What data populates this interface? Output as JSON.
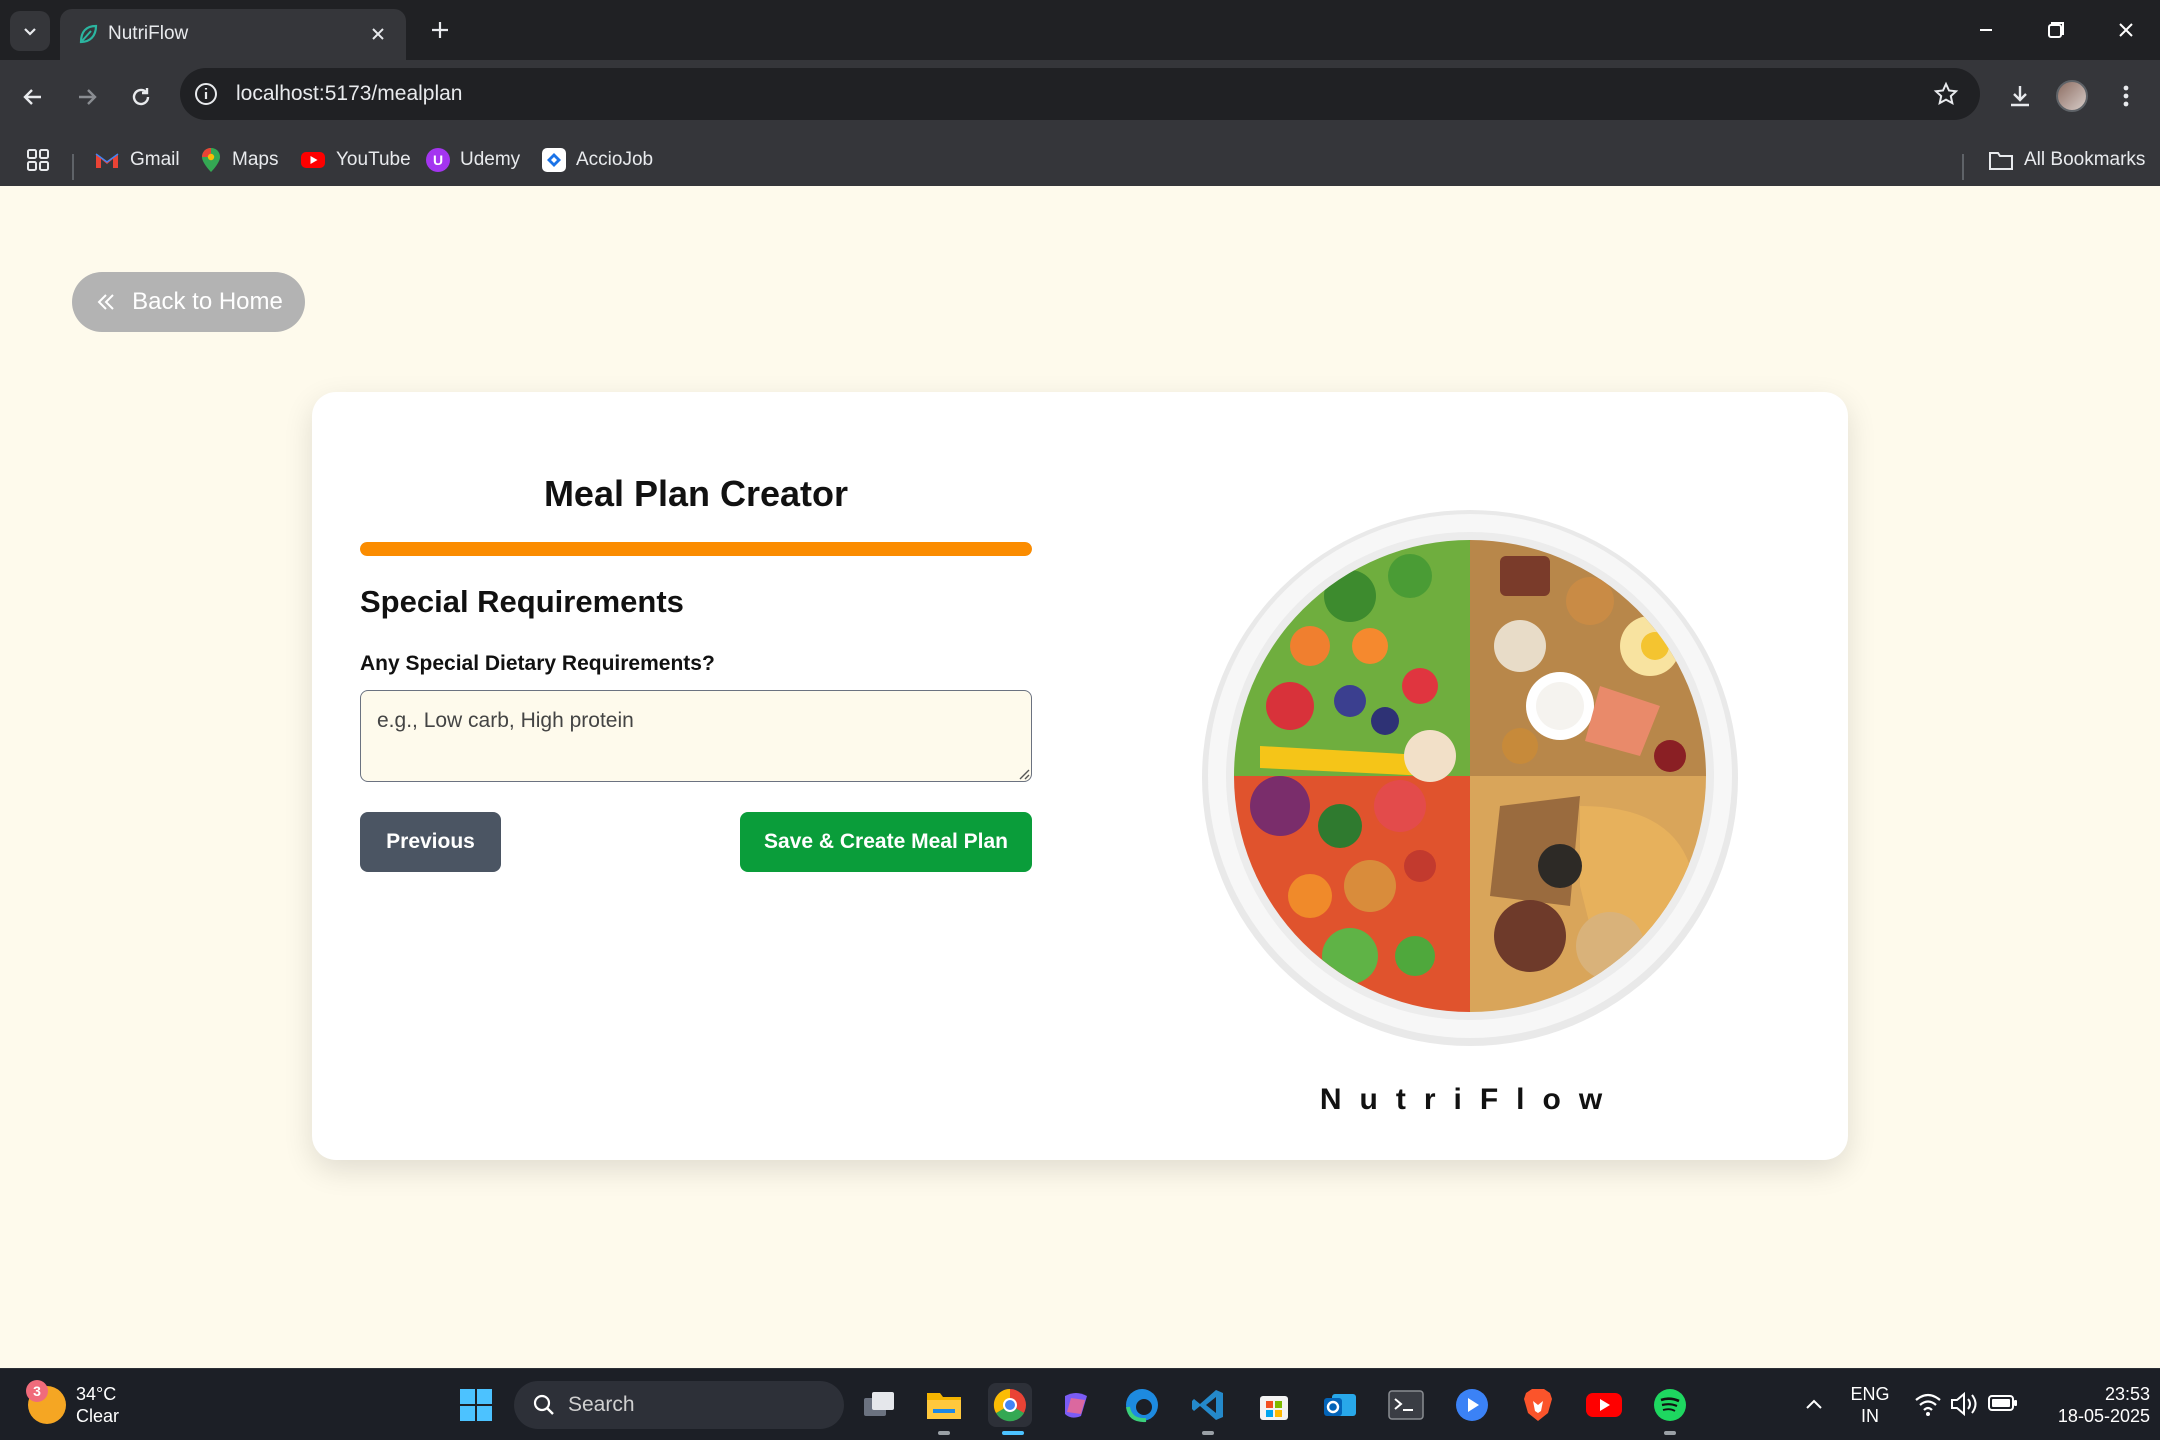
{
  "browser": {
    "tab_title": "NutriFlow",
    "url": "localhost:5173/mealplan",
    "bookmarks": [
      {
        "label": "Gmail",
        "icon": "gmail-icon",
        "color": "#ea4335"
      },
      {
        "label": "Maps",
        "icon": "maps-icon",
        "color": "#34a853"
      },
      {
        "label": "YouTube",
        "icon": "youtube-icon",
        "color": "#ff0000"
      },
      {
        "label": "Udemy",
        "icon": "udemy-icon",
        "color": "#a435f0"
      },
      {
        "label": "AccioJob",
        "icon": "acciojob-icon",
        "color": "#1a73e8"
      }
    ],
    "all_bookmarks_label": "All Bookmarks"
  },
  "page": {
    "back_label": "Back to Home",
    "title": "Meal Plan Creator",
    "progress_percent": 100,
    "section_title": "Special Requirements",
    "field_label": "Any Special Dietary Requirements?",
    "field_placeholder": "e.g., Low carb, High protein",
    "field_value": "",
    "prev_label": "Previous",
    "save_label": "Save & Create Meal Plan",
    "brand_text": "NutriFlow",
    "colors": {
      "background": "#fefaec",
      "progress": "#fb8c00",
      "save": "#0a9d3a",
      "prev": "#4b5563",
      "back": "#b3b3b3"
    }
  },
  "taskbar": {
    "weather_temp": "34°C",
    "weather_desc": "Clear",
    "weather_badge": "3",
    "search_label": "Search",
    "lang_top": "ENG",
    "lang_bottom": "IN",
    "time": "23:53",
    "date": "18-05-2025"
  }
}
